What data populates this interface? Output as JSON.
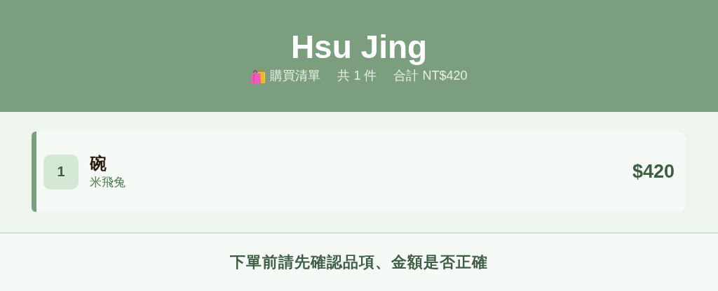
{
  "header": {
    "title": "Hsu Jing",
    "subtitle": [
      "購買清單",
      "共 1 件",
      "合計 NT$420"
    ]
  },
  "items": [
    {
      "number": "1",
      "name": "碗",
      "variant": "米飛兔",
      "price": "$420"
    }
  ],
  "footer": {
    "notice": "下單前請先確認品項、金額是否正確"
  }
}
